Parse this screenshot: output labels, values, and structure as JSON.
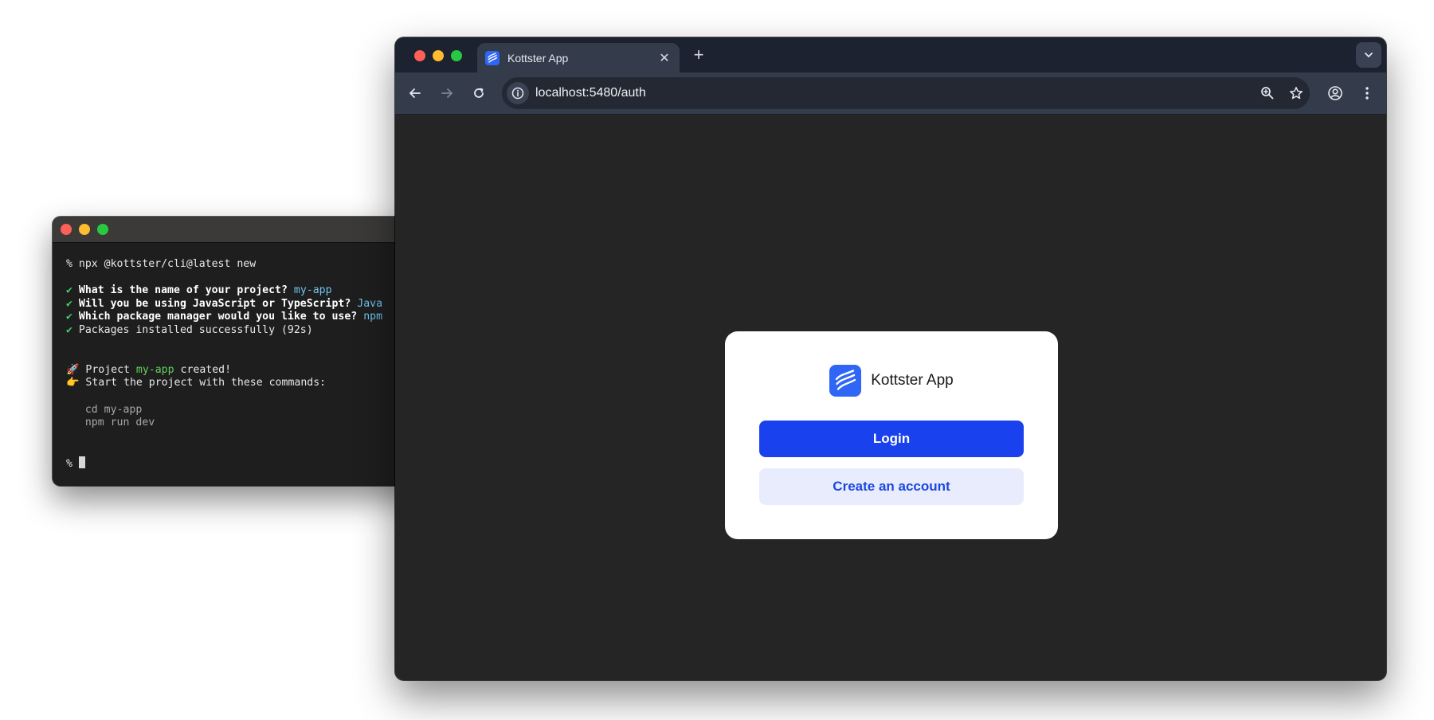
{
  "terminal": {
    "command_line": "% npx @kottster/cli@latest new",
    "questions": [
      {
        "check": "✔",
        "question": "What is the name of your project?",
        "answer": "my-app"
      },
      {
        "check": "✔",
        "question": "Will you be using JavaScript or TypeScript?",
        "answer": "Java"
      },
      {
        "check": "✔",
        "question": "Which package manager would you like to use?",
        "answer": "npm"
      }
    ],
    "installed": {
      "check": "✔",
      "text": "Packages installed successfully (92s)"
    },
    "created": {
      "emoji": "🚀",
      "prefix": "Project",
      "name": "my-app",
      "suffix": "created!"
    },
    "start": {
      "emoji": "👉",
      "text": "Start the project with these commands:"
    },
    "commands": [
      "cd my-app",
      "npm run dev"
    ],
    "prompt": "%"
  },
  "browser": {
    "tab_title": "Kottster App",
    "tab_close": "✕",
    "new_tab": "+",
    "url": "localhost:5480/auth"
  },
  "auth": {
    "app_name": "Kottster App",
    "login_label": "Login",
    "create_label": "Create an account"
  },
  "colors": {
    "accent": "#1942ee",
    "accent_soft": "#e8ecfc",
    "browser_chrome": "#343b4b",
    "terminal_bg": "#1e1e1e"
  }
}
